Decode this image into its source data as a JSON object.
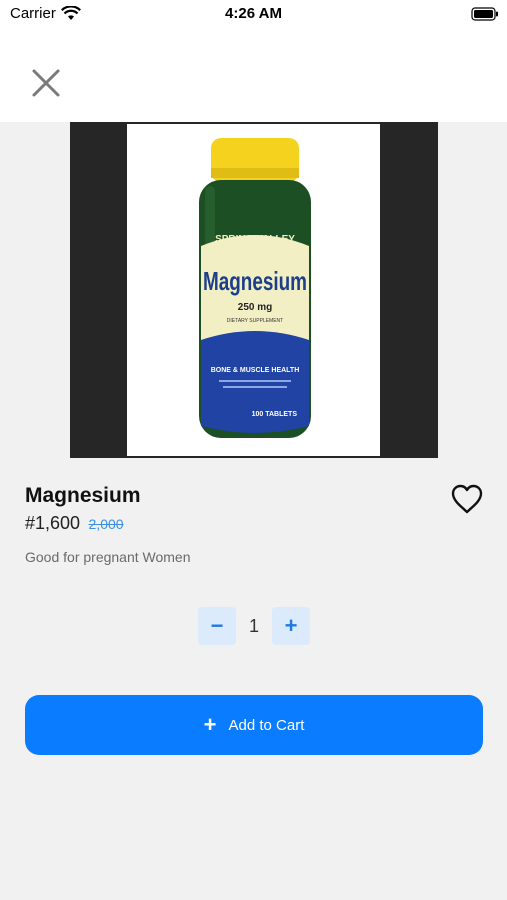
{
  "status_bar": {
    "carrier": "Carrier",
    "time": "4:26 AM"
  },
  "nav": {
    "close_icon": "close-icon"
  },
  "product": {
    "name": "Magnesium",
    "price": "#1,600",
    "old_price": "2,000",
    "description": "Good for pregnant Women",
    "quantity": "1",
    "image_text": {
      "brand": "SPRING VALLEY",
      "label": "Magnesium",
      "dose": "250 mg",
      "sub": "DIETARY SUPPLEMENT",
      "band": "BONE & MUSCLE HEALTH",
      "count": "100 TABLETS"
    }
  },
  "stepper": {
    "minus_label": "−",
    "plus_label": "+"
  },
  "actions": {
    "add_to_cart_icon": "+",
    "add_to_cart_label": "Add to Cart"
  },
  "colors": {
    "accent": "#0a7cff",
    "stepper_bg": "#dcebfb",
    "old_price": "#3d8fe0"
  }
}
